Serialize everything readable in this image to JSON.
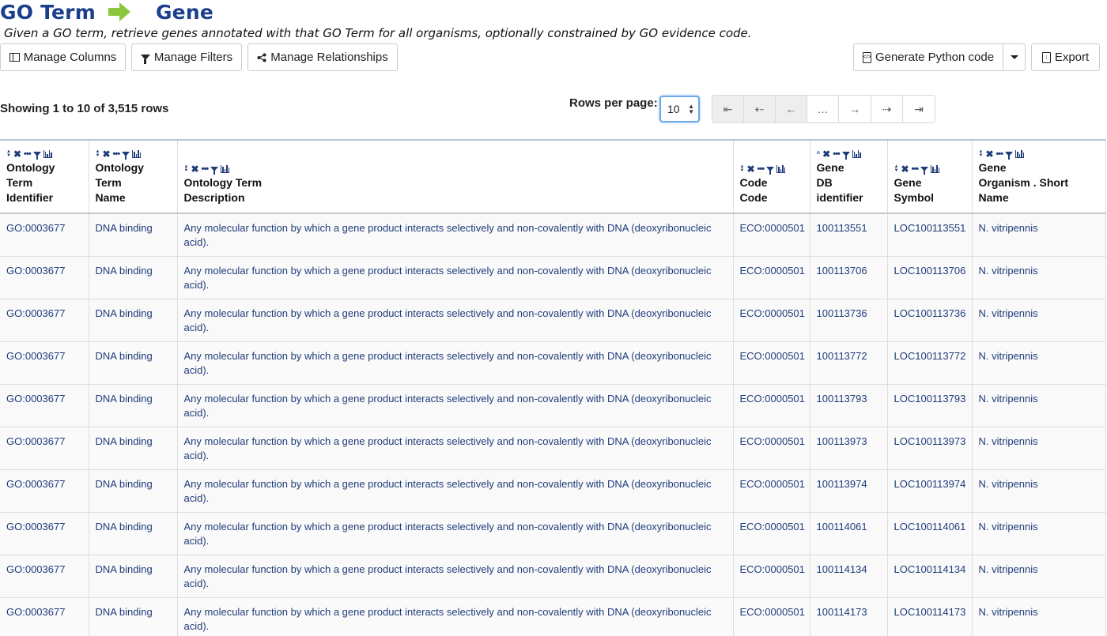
{
  "header": {
    "title_from": "GO Term",
    "title_to": "Gene",
    "subtitle": "Given a GO term, retrieve genes annotated with that GO Term for all organisms, optionally constrained by GO evidence code."
  },
  "toolbar": {
    "manage_columns": "Manage Columns",
    "manage_filters": "Manage Filters",
    "manage_relationships": "Manage Relationships",
    "generate_code": "Generate Python code",
    "export": "Export"
  },
  "pagination": {
    "showing": "Showing 1 to 10 of 3,515 rows",
    "rows_per_page_label": "Rows per page:",
    "rows_per_page_value": "10",
    "buttons": [
      "⇤",
      "⇠",
      "←",
      "…",
      "→",
      "⇢",
      "⇥"
    ]
  },
  "table": {
    "columns": [
      {
        "line1": "Ontology",
        "line2": "Term",
        "line3": "Identifier"
      },
      {
        "line1": "Ontology",
        "line2": "Term",
        "line3": "Name"
      },
      {
        "line1": "",
        "line2": "Ontology Term",
        "line3": "Description"
      },
      {
        "line1": "",
        "line2": "Code",
        "line3": "Code"
      },
      {
        "line1": "Gene",
        "line2": "DB",
        "line3": "identifier"
      },
      {
        "line1": "",
        "line2": "Gene",
        "line3": "Symbol"
      },
      {
        "line1": "Gene",
        "line2": "Organism . Short",
        "line3": "Name"
      }
    ],
    "rows": [
      [
        "GO:0003677",
        "DNA binding",
        "Any molecular function by which a gene product interacts selectively and non-covalently with DNA (deoxyribonucleic acid).",
        "ECO:0000501",
        "100113551",
        "LOC100113551",
        "N. vitripennis"
      ],
      [
        "GO:0003677",
        "DNA binding",
        "Any molecular function by which a gene product interacts selectively and non-covalently with DNA (deoxyribonucleic acid).",
        "ECO:0000501",
        "100113706",
        "LOC100113706",
        "N. vitripennis"
      ],
      [
        "GO:0003677",
        "DNA binding",
        "Any molecular function by which a gene product interacts selectively and non-covalently with DNA (deoxyribonucleic acid).",
        "ECO:0000501",
        "100113736",
        "LOC100113736",
        "N. vitripennis"
      ],
      [
        "GO:0003677",
        "DNA binding",
        "Any molecular function by which a gene product interacts selectively and non-covalently with DNA (deoxyribonucleic acid).",
        "ECO:0000501",
        "100113772",
        "LOC100113772",
        "N. vitripennis"
      ],
      [
        "GO:0003677",
        "DNA binding",
        "Any molecular function by which a gene product interacts selectively and non-covalently with DNA (deoxyribonucleic acid).",
        "ECO:0000501",
        "100113793",
        "LOC100113793",
        "N. vitripennis"
      ],
      [
        "GO:0003677",
        "DNA binding",
        "Any molecular function by which a gene product interacts selectively and non-covalently with DNA (deoxyribonucleic acid).",
        "ECO:0000501",
        "100113973",
        "LOC100113973",
        "N. vitripennis"
      ],
      [
        "GO:0003677",
        "DNA binding",
        "Any molecular function by which a gene product interacts selectively and non-covalently with DNA (deoxyribonucleic acid).",
        "ECO:0000501",
        "100113974",
        "LOC100113974",
        "N. vitripennis"
      ],
      [
        "GO:0003677",
        "DNA binding",
        "Any molecular function by which a gene product interacts selectively and non-covalently with DNA (deoxyribonucleic acid).",
        "ECO:0000501",
        "100114061",
        "LOC100114061",
        "N. vitripennis"
      ],
      [
        "GO:0003677",
        "DNA binding",
        "Any molecular function by which a gene product interacts selectively and non-covalently with DNA (deoxyribonucleic acid).",
        "ECO:0000501",
        "100114134",
        "LOC100114134",
        "N. vitripennis"
      ],
      [
        "GO:0003677",
        "DNA binding",
        "Any molecular function by which a gene product interacts selectively and non-covalently with DNA (deoxyribonucleic acid).",
        "ECO:0000501",
        "100114173",
        "LOC100114173",
        "N. vitripennis"
      ]
    ]
  },
  "colors": {
    "title": "#1b3f8b",
    "arrow": "#8cc63f",
    "link_text": "#1f3c7a",
    "focus_ring": "#6aa6e8"
  }
}
